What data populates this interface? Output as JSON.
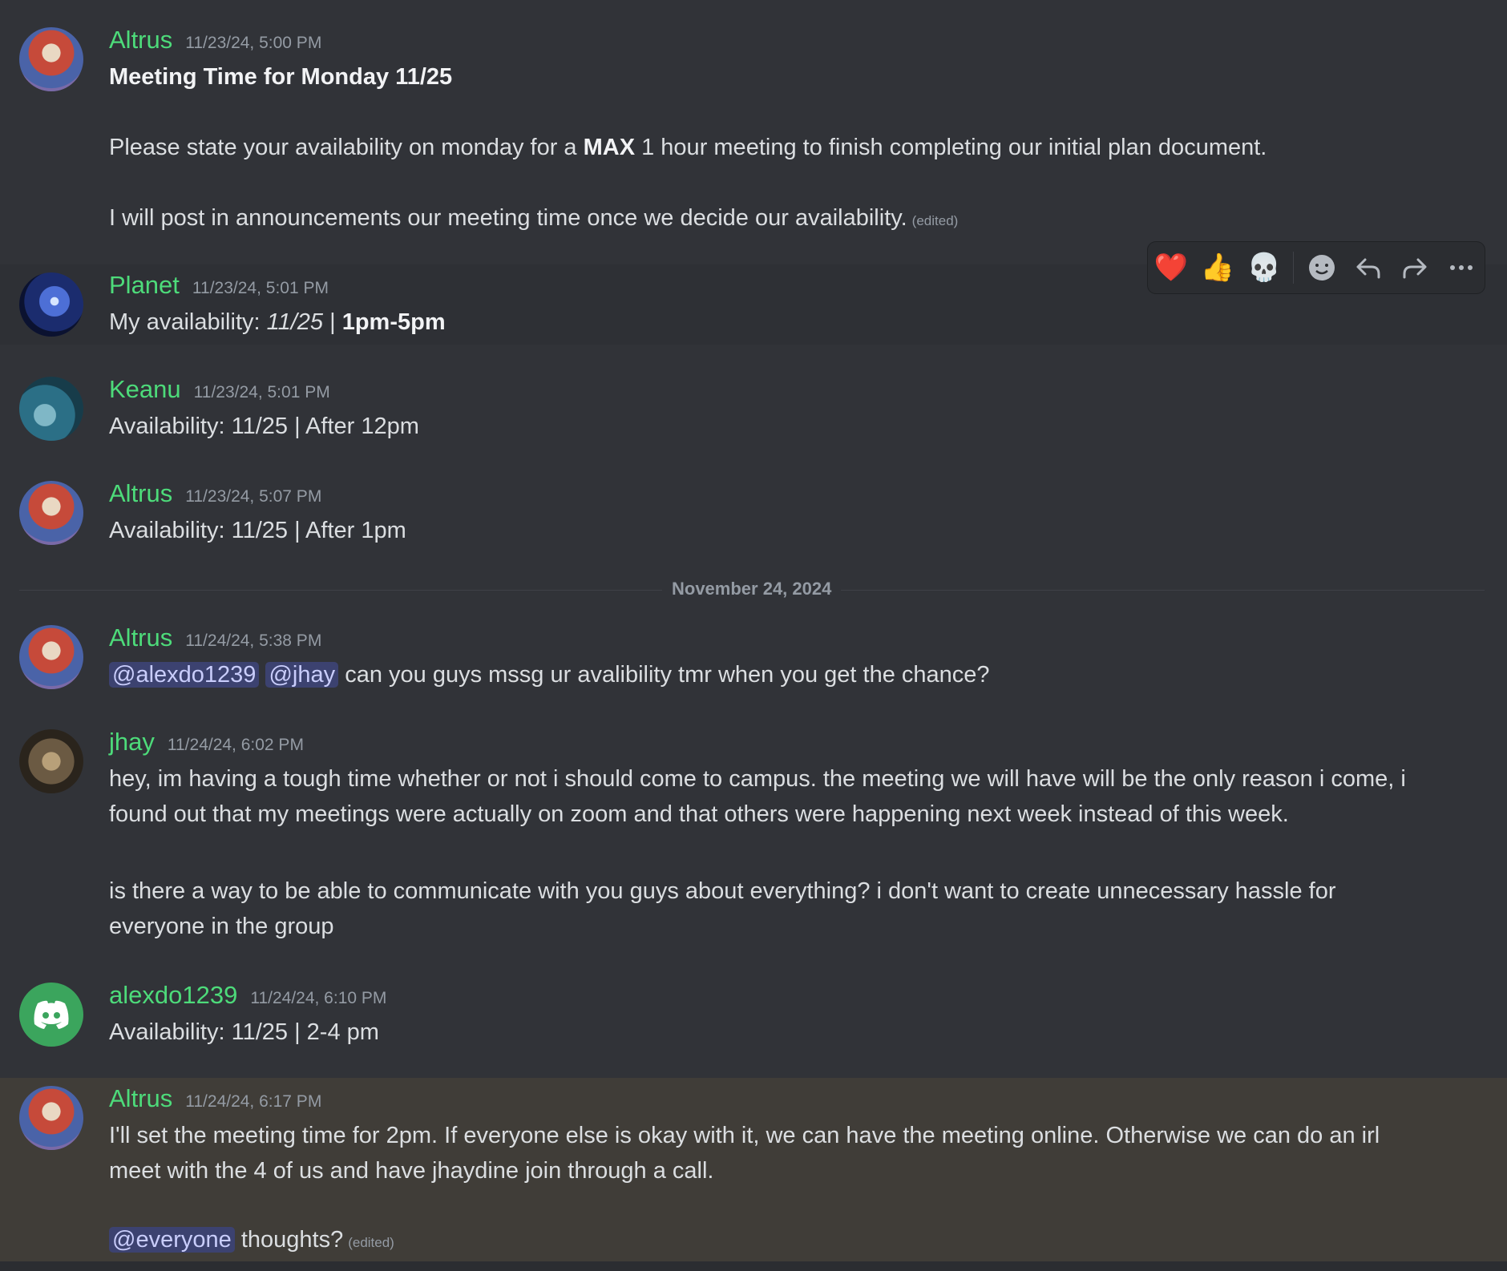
{
  "toolbar": {
    "reactions": [
      "❤️",
      "👍",
      "💀"
    ],
    "icons": [
      "add-reaction-icon",
      "reply-icon",
      "forward-icon",
      "more-icon"
    ]
  },
  "divider": {
    "date": "November 24, 2024"
  },
  "messages": [
    {
      "author": "Altrus",
      "time": "11/23/24, 5:00 PM",
      "title": "Meeting Time for Monday 11/25",
      "p1_a": "Please state your availability on monday for a ",
      "p1_bold": "MAX",
      "p1_b": " 1 hour meeting to finish completing our initial plan document.",
      "p2": "I will post in announcements our meeting time once we decide our availability.",
      "edited": "(edited)"
    },
    {
      "author": "Planet",
      "time": "11/23/24, 5:01 PM",
      "a": "My availability: ",
      "ital": "11/25",
      "b": " | ",
      "bold": "1pm-5pm"
    },
    {
      "author": "Keanu",
      "time": "11/23/24, 5:01 PM",
      "text": "Availability: 11/25 | After 12pm"
    },
    {
      "author": "Altrus",
      "time": "11/23/24, 5:07 PM",
      "text": "Availability: 11/25 | After 1pm"
    },
    {
      "author": "Altrus",
      "time": "11/24/24, 5:38 PM",
      "mention1": "@alexdo1239",
      "mention2": "@jhay",
      "text": "can you guys mssg ur avalibility tmr when you get the chance?"
    },
    {
      "author": "jhay",
      "time": "11/24/24, 6:02 PM",
      "p1": "hey, im having a tough time whether or not i should come to campus. the meeting we will have will be the only reason i come, i found out that my meetings were actually on zoom and that others were happening next week instead of this week.",
      "p2": "is there a way to be able to communicate with you guys about everything? i don't want to create unnecessary hassle for everyone in the group"
    },
    {
      "author": "alexdo1239",
      "time": "11/24/24, 6:10 PM",
      "text": "Availability: 11/25 | 2-4 pm"
    },
    {
      "author": "Altrus",
      "time": "11/24/24, 6:17 PM",
      "p1": "I'll set the meeting time for 2pm. If everyone else is okay with it, we can have the meeting online. Otherwise we can do an irl meet with the 4 of us and have jhaydine join through a call.",
      "mention": "@everyone",
      "p2": "thoughts?",
      "edited": "(edited)"
    }
  ]
}
